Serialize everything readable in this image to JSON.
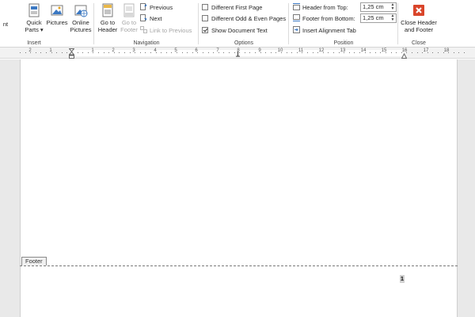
{
  "ribbon": {
    "insert": {
      "group_label": "Insert",
      "cut_label": "nt",
      "quick_parts_line1": "Quick",
      "quick_parts_line2": "Parts",
      "pictures": "Pictures",
      "online_pictures_line1": "Online",
      "online_pictures_line2": "Pictures"
    },
    "navigation": {
      "group_label": "Navigation",
      "go_to_header_line1": "Go to",
      "go_to_header_line2": "Header",
      "go_to_footer_line1": "Go to",
      "go_to_footer_line2": "Footer",
      "previous": "Previous",
      "next": "Next",
      "link_to_previous": "Link to Previous"
    },
    "options": {
      "group_label": "Options",
      "different_first_page": "Different First Page",
      "different_first_page_checked": false,
      "different_odd_even": "Different Odd & Even Pages",
      "different_odd_even_checked": false,
      "show_document_text": "Show Document Text",
      "show_document_text_checked": true
    },
    "position": {
      "group_label": "Position",
      "header_from_top_label": "Header from Top:",
      "header_from_top_value": "1,25 cm",
      "footer_from_bottom_label": "Footer from Bottom:",
      "footer_from_bottom_value": "1,25 cm",
      "insert_alignment_tab": "Insert Alignment Tab"
    },
    "close": {
      "group_label": "Close",
      "close_line1": "Close Header",
      "close_line2": "and Footer",
      "accent": "#d9452a"
    }
  },
  "ruler": {
    "labels": [
      "2",
      "1",
      "1",
      "2",
      "3",
      "4",
      "5",
      "6",
      "7",
      "8",
      "9",
      "10",
      "11",
      "12",
      "13",
      "14",
      "15",
      "16",
      "17",
      "18"
    ]
  },
  "document": {
    "footer_tag": "Footer",
    "page_number": "1"
  }
}
